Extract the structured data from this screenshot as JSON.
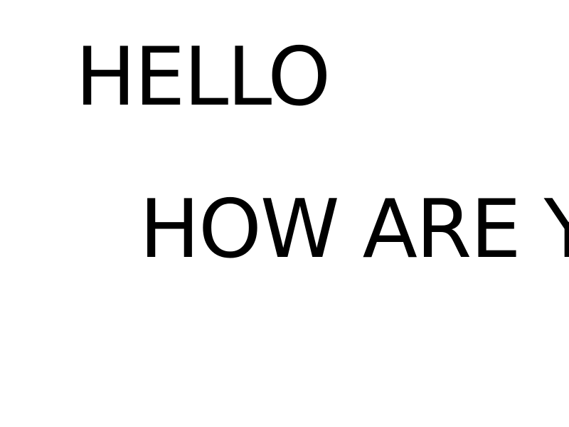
{
  "lines": [
    "HELLO",
    "HOW ARE Y"
  ]
}
